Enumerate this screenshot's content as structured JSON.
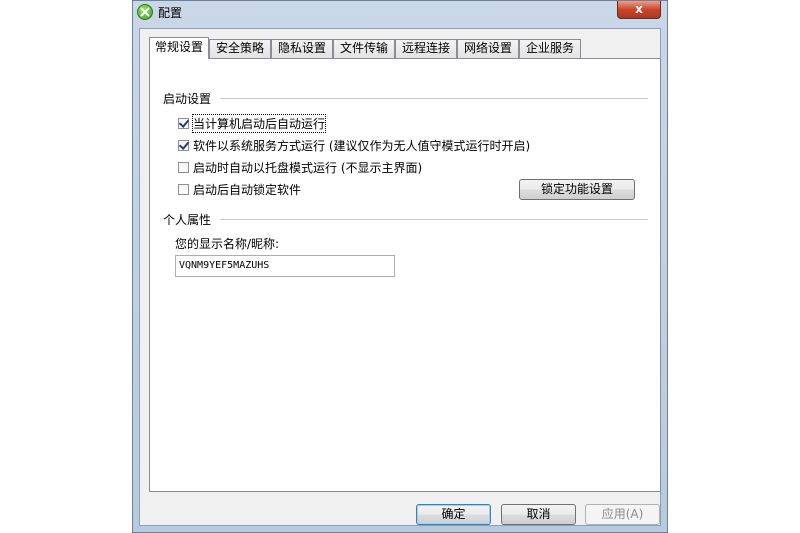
{
  "window": {
    "title": "配置",
    "close_glyph": "x"
  },
  "tabs": [
    {
      "label": "常规设置",
      "active": true
    },
    {
      "label": "安全策略",
      "active": false
    },
    {
      "label": "隐私设置",
      "active": false
    },
    {
      "label": "文件传输",
      "active": false
    },
    {
      "label": "远程连接",
      "active": false
    },
    {
      "label": "网络设置",
      "active": false
    },
    {
      "label": "企业服务",
      "active": false
    }
  ],
  "startup": {
    "title": "启动设置",
    "options": [
      {
        "label": "当计算机启动后自动运行",
        "checked": true
      },
      {
        "label": "软件以系统服务方式运行 (建议仅作为无人值守模式运行时开启)",
        "checked": true
      },
      {
        "label": "启动时自动以托盘模式运行 (不显示主界面)",
        "checked": false
      },
      {
        "label": "启动后自动锁定软件",
        "checked": false
      }
    ],
    "lock_settings_button": "锁定功能设置"
  },
  "personal": {
    "title": "个人属性",
    "name_label": "您的显示名称/昵称:",
    "name_value": "VQNM9YEF5MAZUHS"
  },
  "footer": {
    "ok": "确定",
    "cancel": "取消",
    "apply": "应用(A)"
  },
  "colors": {
    "close": "#c7472c",
    "frame": "#b8cade",
    "default_button": "#3c7fb1"
  },
  "icons": {
    "app": "app-logo-icon",
    "close": "close-icon",
    "check": "checkmark-icon"
  }
}
